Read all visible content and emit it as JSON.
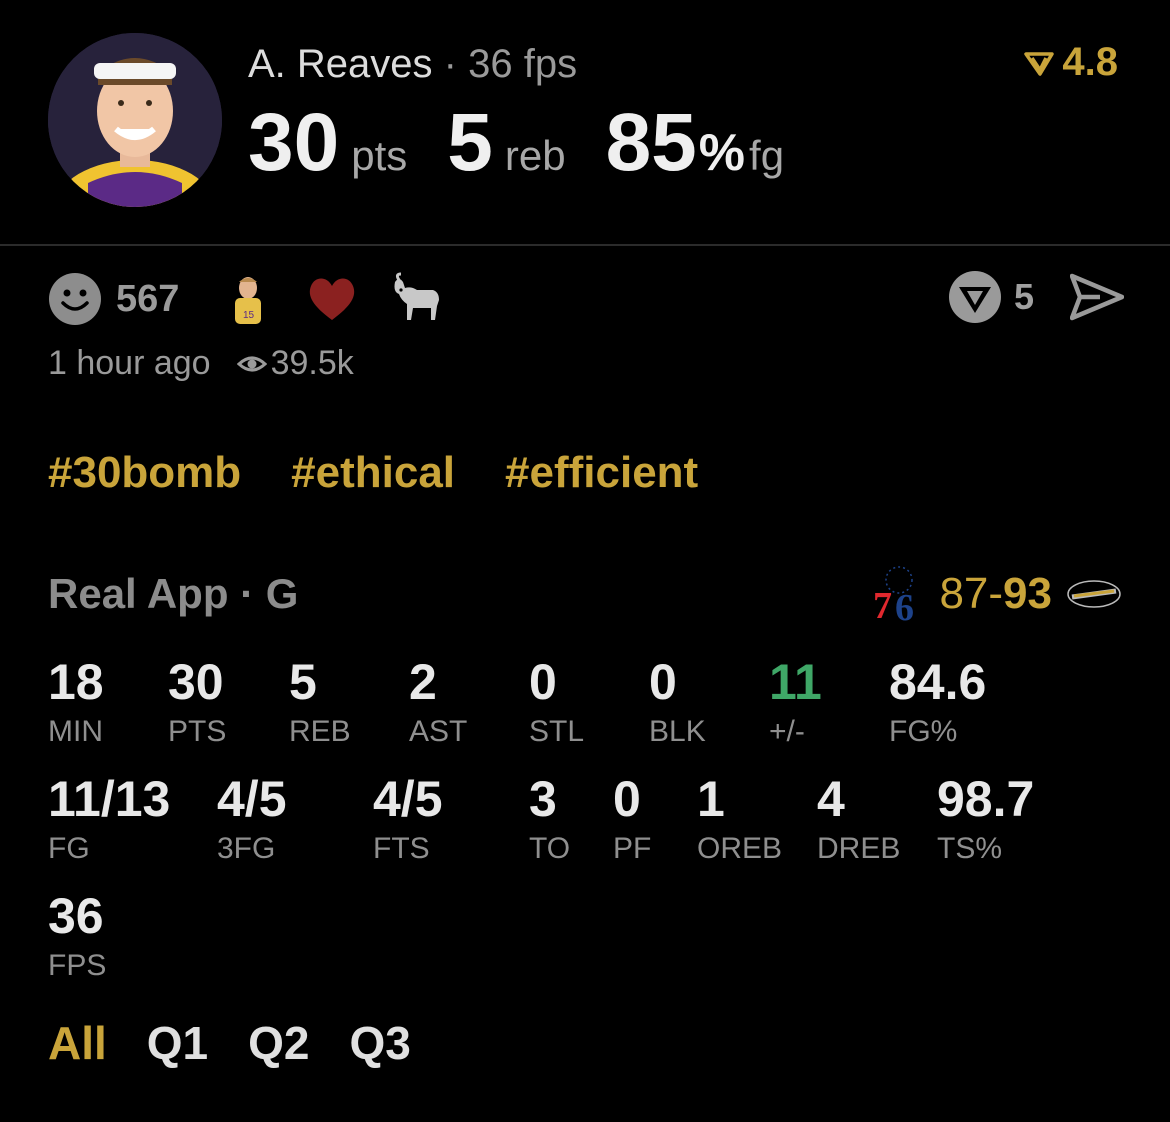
{
  "header": {
    "player_name": "A. Reaves",
    "separator": "·",
    "fps_label": "36 fps",
    "rating": "4.8",
    "headline": {
      "pts_value": "30",
      "pts_unit": "pts",
      "reb_value": "5",
      "reb_unit": "reb",
      "fg_value": "85",
      "fg_pct": "%",
      "fg_unit": "fg"
    }
  },
  "reactions": {
    "count": "567",
    "icons": [
      "smiley-icon",
      "player-sticker-icon",
      "heart-icon",
      "goat-icon"
    ],
    "vote_count": "5"
  },
  "meta": {
    "time_ago": "1 hour ago",
    "views": "39.5k"
  },
  "tags": [
    "#30bomb",
    "#ethical",
    "#efficient"
  ],
  "game": {
    "league": "Real App · G",
    "away_score": "87",
    "dash": "-",
    "home_score": "93"
  },
  "stats_row1": [
    {
      "value": "18",
      "label": "MIN"
    },
    {
      "value": "30",
      "label": "PTS"
    },
    {
      "value": "5",
      "label": "REB"
    },
    {
      "value": "2",
      "label": "AST"
    },
    {
      "value": "0",
      "label": "STL"
    },
    {
      "value": "0",
      "label": "BLK"
    },
    {
      "value": "11",
      "label": "+/-"
    },
    {
      "value": "84.6",
      "label": "FG%"
    }
  ],
  "stats_row2": [
    {
      "value": "11/13",
      "label": "FG"
    },
    {
      "value": "4/5",
      "label": "3FG"
    },
    {
      "value": "4/5",
      "label": "FTS"
    },
    {
      "value": "3",
      "label": "TO"
    },
    {
      "value": "0",
      "label": "PF"
    },
    {
      "value": "1",
      "label": "OREB"
    },
    {
      "value": "4",
      "label": "DREB"
    },
    {
      "value": "98.7",
      "label": "TS%"
    }
  ],
  "stats_row3": [
    {
      "value": "36",
      "label": "FPS"
    }
  ],
  "tabs": [
    {
      "label": "All",
      "active": true
    },
    {
      "label": "Q1",
      "active": false
    },
    {
      "label": "Q2",
      "active": false
    },
    {
      "label": "Q3",
      "active": false
    }
  ],
  "colors": {
    "accent_gold": "#c9a43a",
    "positive_green": "#3fa767",
    "background": "#000000"
  }
}
